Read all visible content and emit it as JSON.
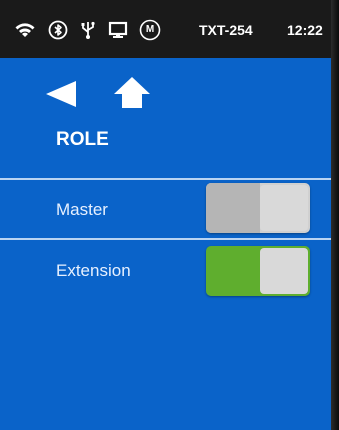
{
  "status_bar": {
    "device_id": "TXT-254",
    "time": "12:22",
    "motor_badge": "M",
    "icons": [
      "wifi-icon",
      "bluetooth-icon",
      "usb-icon",
      "display-icon",
      "motor-icon"
    ]
  },
  "nav": {
    "back_icon": "back-arrow-icon",
    "home_icon": "home-icon"
  },
  "page": {
    "title": "ROLE"
  },
  "settings": {
    "rows": [
      {
        "label": "Master",
        "enabled": false
      },
      {
        "label": "Extension",
        "enabled": true
      }
    ]
  },
  "colors": {
    "screen_background": "#0a63c9",
    "status_bar_background": "#1a1a1a",
    "toggle_on_track": "#5fae2e",
    "toggle_off_track": "#bdbdbd",
    "toggle_knob": "#d9d9d9",
    "divider": "#b9d4f3"
  }
}
